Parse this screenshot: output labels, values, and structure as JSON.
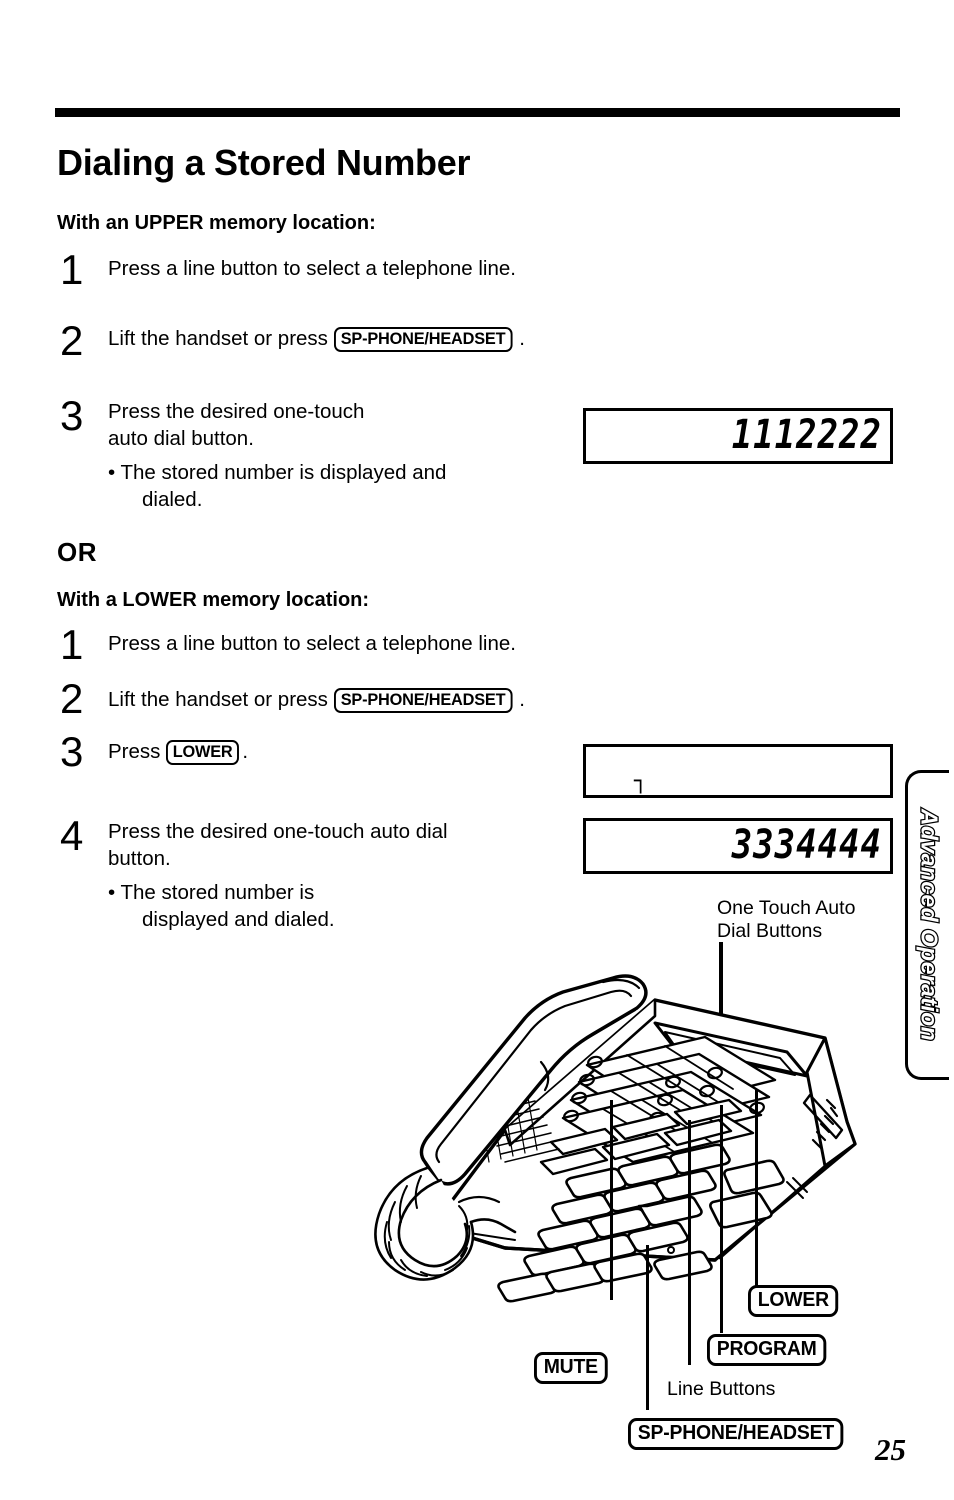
{
  "document": {
    "title": "Dialing a Stored Number",
    "page_number": "25",
    "side_tab": "Advanced Operation"
  },
  "sections": [
    {
      "heading": "With an UPPER memory location:",
      "steps": [
        {
          "num": "1",
          "text": "Press a line button to select a telephone line."
        },
        {
          "num": "2",
          "text_before": "Lift the handset or press",
          "key": "SP-PHONE/HEADSET",
          "text_after": "."
        },
        {
          "num": "3",
          "line1": "Press the desired one-touch",
          "line2": "auto dial button.",
          "bullet": "• The stored number is displayed and",
          "bullet2": "dialed."
        }
      ]
    },
    {
      "divider": "OR",
      "heading": "With a LOWER memory location:",
      "steps": [
        {
          "num": "1",
          "text": "Press a line button to select a telephone line."
        },
        {
          "num": "2",
          "text_before": "Lift the handset or press",
          "key": "SP-PHONE/HEADSET",
          "text_after": "."
        },
        {
          "num": "3",
          "text_before": "Press",
          "key": "LOWER",
          "text_after": "."
        },
        {
          "num": "4",
          "line1": "Press the desired one-touch auto dial",
          "line2": "button.",
          "bullet": "• The stored number is",
          "bullet2": "displayed and dialed."
        }
      ]
    }
  ],
  "displays": [
    {
      "id": "upper-result",
      "digits": "1112222"
    },
    {
      "id": "lower-indicator",
      "indicator": "┐"
    },
    {
      "id": "lower-result",
      "digits": "3334444"
    }
  ],
  "callouts": {
    "one_touch": "One Touch Auto\nDial Buttons",
    "one_touch_line1": "One Touch Auto",
    "one_touch_line2": "Dial Buttons",
    "lower": "LOWER",
    "program": "PROGRAM",
    "mute": "MUTE",
    "line_buttons": "Line Buttons",
    "sp_phone": "SP-PHONE/HEADSET"
  }
}
